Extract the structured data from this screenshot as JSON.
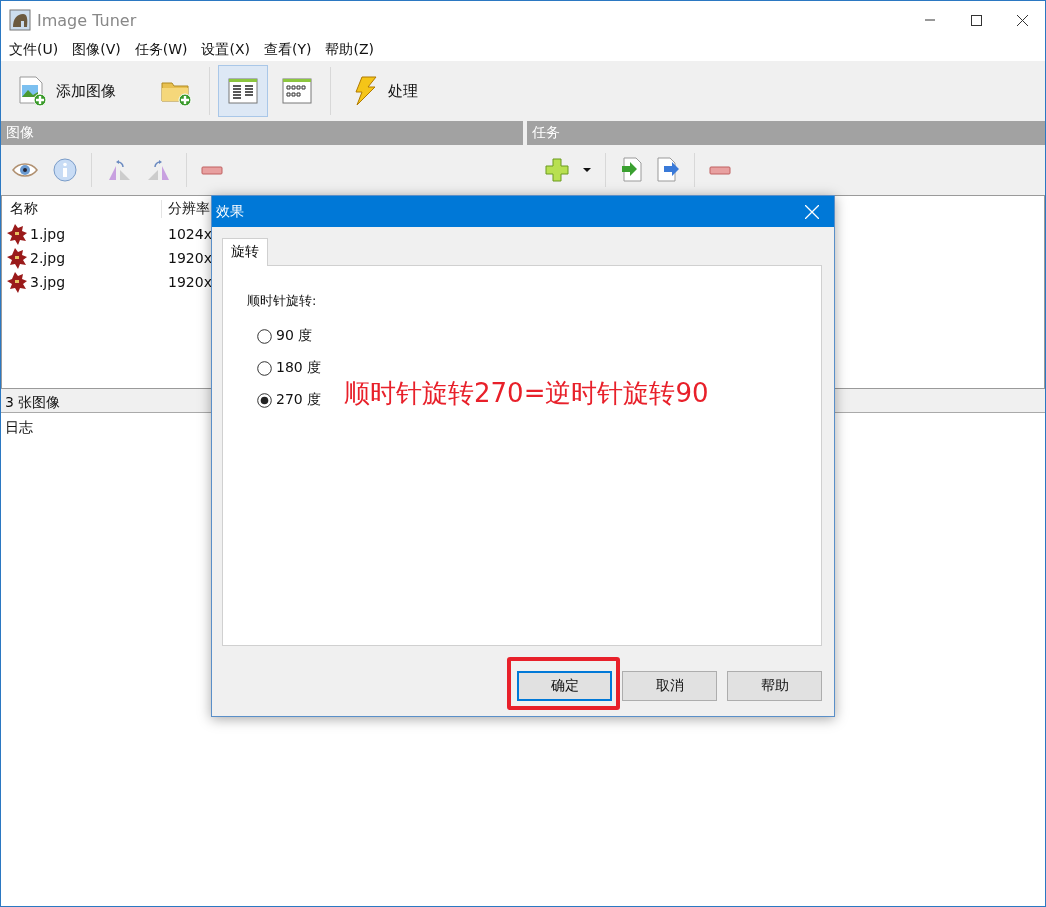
{
  "window": {
    "title": "Image Tuner"
  },
  "menu": [
    {
      "label": "文件(U)"
    },
    {
      "label": "图像(V)"
    },
    {
      "label": "任务(W)"
    },
    {
      "label": "设置(X)"
    },
    {
      "label": "查看(Y)"
    },
    {
      "label": "帮助(Z)"
    }
  ],
  "toolbar": [
    {
      "kind": "add-image",
      "label": "添加图像"
    },
    {
      "kind": "add-folder"
    },
    {
      "kind": "list-view",
      "selected": true
    },
    {
      "kind": "grid-view",
      "selected": false
    },
    {
      "kind": "process",
      "label": "处理"
    }
  ],
  "images_panel": {
    "title": "图像",
    "columns": [
      "名称",
      "分辨率"
    ],
    "rows": [
      {
        "name": "1.jpg",
        "resolution": "1024x"
      },
      {
        "name": "2.jpg",
        "resolution": "1920x"
      },
      {
        "name": "3.jpg",
        "resolution": "1920x"
      }
    ],
    "status": "3 张图像"
  },
  "tasks_panel": {
    "title": "任务"
  },
  "log": {
    "title": "日志"
  },
  "dialog": {
    "title": "效果",
    "tabs": [
      {
        "label": "旋转",
        "selected": true
      }
    ],
    "group_label": "顺时针旋转:",
    "options": [
      {
        "label": "90 度",
        "selected": false
      },
      {
        "label": "180 度",
        "selected": false
      },
      {
        "label": "270 度",
        "selected": true
      }
    ],
    "buttons": [
      {
        "label": "确定",
        "default": true
      },
      {
        "label": "取消",
        "default": false
      },
      {
        "label": "帮助",
        "default": false
      }
    ]
  },
  "annotation": {
    "text": "顺时针旋转270=逆时针旋转90"
  }
}
